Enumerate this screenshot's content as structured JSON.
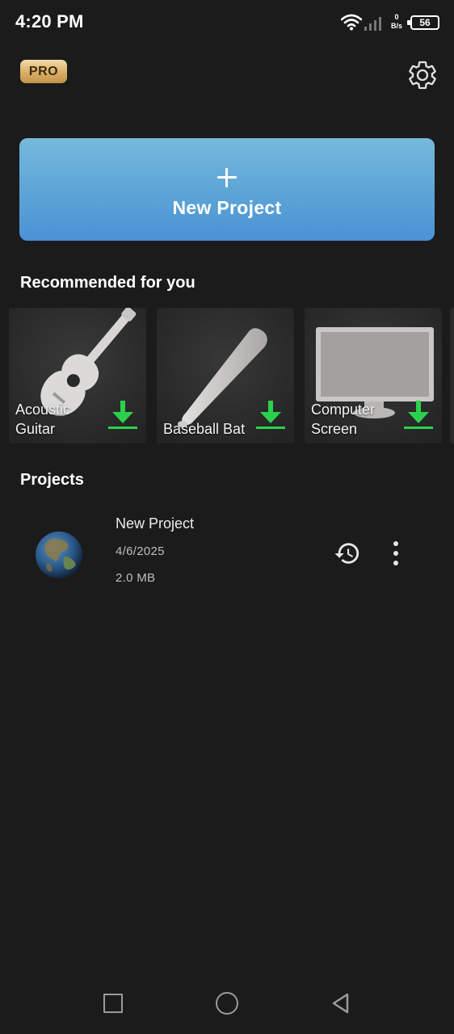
{
  "status_bar": {
    "time": "4:20 PM",
    "net_speed_value": "0",
    "net_speed_unit": "B/s",
    "battery": "56",
    "icons": [
      "wifi-icon",
      "signal-icon",
      "battery-icon"
    ]
  },
  "header": {
    "badge": "PRO",
    "settings_icon": "gear-icon"
  },
  "new_project": {
    "icon": "plus-icon",
    "label": "New Project"
  },
  "recommended": {
    "title": "Recommended for you",
    "items": [
      {
        "label": "Acoustic Guitar",
        "icon": "download-icon"
      },
      {
        "label": "Baseball Bat",
        "icon": "download-icon"
      },
      {
        "label": "Computer Screen",
        "icon": "download-icon"
      }
    ]
  },
  "projects": {
    "title": "Projects",
    "items": [
      {
        "name": "New Project",
        "date": "4/6/2025",
        "size": "2.0 MB",
        "icons": [
          "history-icon",
          "more-vertical-icon"
        ]
      }
    ]
  },
  "colors": {
    "background": "#1b1b1b",
    "accent_blue": "#5aa2d6",
    "download_green": "#2bd14c",
    "pro_gold": "#d9ae66"
  },
  "nav_bar": {
    "icons": [
      "recents-icon",
      "home-icon",
      "back-icon"
    ]
  }
}
